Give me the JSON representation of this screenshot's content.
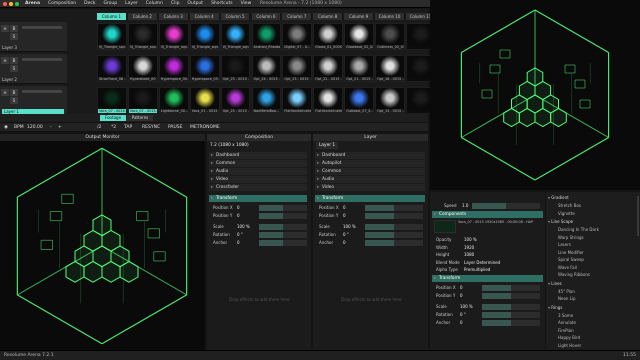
{
  "menubar": {
    "app": "Arena",
    "menus": [
      "Composition",
      "Deck",
      "Group",
      "Layer",
      "Column",
      "Clip",
      "Output",
      "Shortcuts",
      "View"
    ],
    "window_title": "Resolume Arena - 7.2 (1080 x 1080)"
  },
  "columns": [
    "Column 1",
    "Column 2",
    "Column 3",
    "Column 4",
    "Column 5",
    "Column 6",
    "Column 7",
    "Column 8",
    "Column 9",
    "Column 10",
    "Column 11"
  ],
  "layers": [
    {
      "label": "Layer 3",
      "clips": [
        "VJ_Triangle_sqn...",
        "VJ_Triangle_sqn...",
        "VJ_Triangle_sqn...",
        "VJ_Triangle_sqn...",
        "VJ_Triangle_sqn...",
        "Android_Rheato...",
        "Digital_07 - 0...",
        "Glows_01_000S...",
        "Glowbeat_02_02...",
        "Outliness_02_03..."
      ],
      "thumb_colors": [
        "#1fd7c9",
        "#2b2b2b",
        "#e93ccf",
        "#1d8cf0",
        "#33b2ff",
        "#0f9e6a",
        "#7d7d7d",
        "#cfcfcf",
        "#e6e6e6",
        "#4d4d4d",
        "#1c1c1c"
      ]
    },
    {
      "label": "Layer 2",
      "clips": [
        "StraeTrace_08 - ...",
        "Hyperblade_00 ...",
        "Hyperspace_00...",
        "Hyperspace_05...",
        "Opt_25 - 0015 ...",
        "Opt_24 - 0015 ...",
        "Opt_23 - 0015 ...",
        "Opt_22 - 0015 ...",
        "Opt_21 - 0015 ...",
        "Opt_16 - 0015 ..."
      ],
      "thumb_colors": [
        "#6b3bd6",
        "#d9d9d9",
        "#c02bdc",
        "#2a6ee0",
        "#1a1a1a",
        "#bdbdbd",
        "#8a8a8a",
        "#d0d0d0",
        "#a9a9a9",
        "#e0e0e0",
        "#1c1c1c"
      ]
    },
    {
      "label": "Layer 1",
      "clips": [
        "Vocs_07 - 0015...",
        "Vocs_07 - 0015...",
        "Lightdome_00...",
        "Vocs_01 - 0015 ...",
        "Opt_25 - 0015 ...",
        "NonMetalBoo...",
        "FlatVanistricade...",
        "FlatVanistricade...",
        "Outblast_07_0...",
        "Opt_13 - 0015 ..."
      ],
      "thumb_colors": [
        "#0a2d1a",
        "#1a1a1a",
        "#1fbf5a",
        "#e8e04a",
        "#b83ad9",
        "#2fa3e8",
        "#7cd0ff",
        "#e2e2e2",
        "#3c78f0",
        "#c9c9c9",
        "#1c1c1c"
      ]
    }
  ],
  "deck_tabs": [
    "Footage",
    "Patterns"
  ],
  "transport": {
    "bpm_label": "BPM",
    "bpm": "120.00",
    "buttons": [
      "-",
      "+",
      "/2",
      "*2",
      "TAP",
      "RESYNC",
      "PAUSE",
      "METRONOME"
    ]
  },
  "output_monitor": {
    "title": "Output Monitor"
  },
  "composition_panel": {
    "title": "Composition",
    "name": "7.2 (1080 x 1080)",
    "sections": [
      "Dashboard",
      "Common",
      "Audio",
      "Video",
      "Crossfader",
      "Transform"
    ],
    "transform": [
      {
        "label": "Position X",
        "value": "0"
      },
      {
        "label": "Position Y",
        "value": "0"
      },
      {
        "label": "Scale",
        "value": "100 %"
      },
      {
        "label": "Rotation",
        "value": "0 °"
      },
      {
        "label": "Anchor",
        "value": "0"
      }
    ],
    "empty_hint": "Drop effects to add them here"
  },
  "layer_panel": {
    "title": "Layer",
    "name": "Layer 1",
    "sections": [
      "Dashboard",
      "Autopilot",
      "Common",
      "Audio",
      "Video",
      "Transform"
    ],
    "transform": [
      {
        "label": "Position X",
        "value": "0"
      },
      {
        "label": "Position Y",
        "value": "0"
      },
      {
        "label": "Scale",
        "value": "100 %"
      },
      {
        "label": "Rotation",
        "value": "0 °"
      },
      {
        "label": "Anchor",
        "value": "0"
      }
    ],
    "empty_hint": "Drop effects to add them here"
  },
  "clip_panel": {
    "speed_label": "Speed",
    "speed": "1.0",
    "components_label": "Components",
    "file_info": "Vocs_07 - 0015 1920x1080 - 00:00:08 - HAP",
    "props": [
      {
        "label": "Opacity",
        "value": "100 %"
      },
      {
        "label": "Width",
        "value": "1920"
      },
      {
        "label": "Height",
        "value": "1080"
      },
      {
        "label": "Blend Mode",
        "value": "Layer Determined"
      },
      {
        "label": "Alpha Type",
        "value": "Premultiplied"
      }
    ],
    "transform_label": "Transform",
    "transform": [
      {
        "label": "Position X",
        "value": "0"
      },
      {
        "label": "Position Y",
        "value": "0"
      },
      {
        "label": "Scale",
        "value": "100 %"
      },
      {
        "label": "Rotation",
        "value": "0 °"
      },
      {
        "label": "Anchor",
        "value": "0"
      }
    ]
  },
  "browser": {
    "groups": [
      {
        "title": "Gradient",
        "items": [
          "Stretch Box",
          "Vignette"
        ]
      },
      {
        "title": "Line Scape",
        "items": [
          "Dancing In The Dark",
          "Warp Strings",
          "Lasers",
          "Line Modifier",
          "Spiral Sweep",
          "Wave Fall",
          "Waving Ribbons"
        ]
      },
      {
        "title": "Lines",
        "items": [
          "45° Plan",
          "Neon Lip"
        ]
      },
      {
        "title": "Rings",
        "items": [
          "3 Some",
          "Annulate",
          "FirePlan",
          "Happy Bird",
          "Light Hover"
        ]
      }
    ]
  },
  "statusbar": {
    "left": "Resolume Arena 7.2.1",
    "right": "11:55"
  },
  "colors": {
    "accent": "#58e0c8",
    "glow": "#52ff78"
  }
}
